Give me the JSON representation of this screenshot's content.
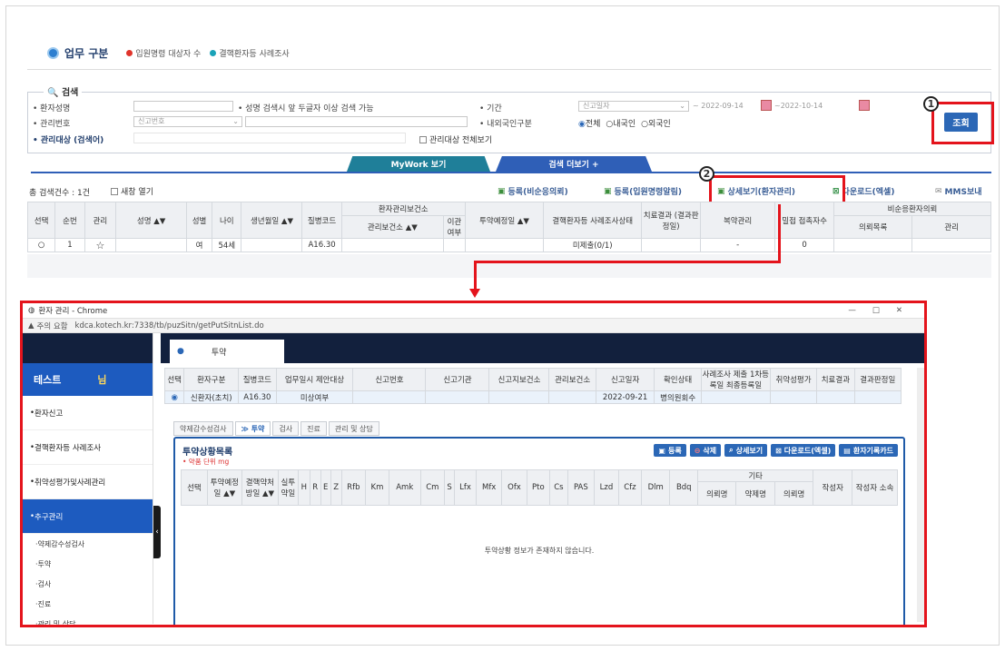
{
  "header": {
    "title": "업무 구분",
    "legend_items": [
      "입원명령 대상자 수",
      "결핵환자등 사례조사"
    ]
  },
  "search": {
    "legend": "검색",
    "patient_name_label": "환자성명",
    "patient_name_hint": "성명 검색시 앞 두글자 이상 검색 가능",
    "mgmt_no_label": "관리번호",
    "mgmt_no_value": "신고번호",
    "target_label": "관리대상 (검색어)",
    "show_all_label": "관리대상 전체보기",
    "period_label": "기간",
    "period_type": "신고일자",
    "date_from": "2022-09-14",
    "date_sep": "~",
    "date_to": "2022-10-14",
    "nationality_label": "내외국인구분",
    "nat_opts": [
      "전체",
      "내국인",
      "외국인"
    ],
    "query_button": "조회"
  },
  "tabs": {
    "mywork": "MyWork 보기",
    "more": "검색 더보기 +"
  },
  "results": {
    "count_label": "총 검색건수 : 1건",
    "new_window": "새창 열기",
    "actions": [
      "등록(비순응의뢰)",
      "등록(입원명령알림)",
      "상세보기(환자관리)",
      "다운로드(엑셀)",
      "MMS보내"
    ]
  },
  "grid": {
    "headers": [
      "선택",
      "순번",
      "관리",
      "성명 ▲▼",
      "성별",
      "나이",
      "생년월일 ▲▼",
      "질병코드",
      "관리보건소 ▲▼",
      "이관 여부",
      "투약예정일 ▲▼",
      "결핵환자등 사례조사상태",
      "치료결과 (결과판정일)",
      "복약관리",
      "밀접 접촉자수",
      "의뢰목록",
      "관리"
    ],
    "group_headers": [
      "환자관리보건소",
      "비순응환자의뢰"
    ],
    "row": {
      "seq": "1",
      "sex": "여",
      "age": "54세",
      "code": "A16.30",
      "status": "미제출(0/1)",
      "med": "-",
      "contacts": "0"
    }
  },
  "markers": {
    "one": "1",
    "two": "2"
  },
  "popup": {
    "window_title": "환자 관리 - Chrome",
    "url_warning": "주의 요함",
    "url": "kdca.kotech.kr:7338/tb/puzSitn/getPutSitnList.do",
    "tab_label": "투약",
    "side_title": "테스트",
    "side_suffix": "님",
    "side_items": [
      "환자신고",
      "결핵환자등 사례조사",
      "취약성평가및사례관리",
      "추구관리"
    ],
    "side_sub": [
      "약제감수성검사",
      "투약",
      "검사",
      "진료",
      "관리 및 상담"
    ],
    "ptable_headers": [
      "선택",
      "환자구분",
      "질병코드",
      "업무일시 제안대상",
      "신고번호",
      "신고기관",
      "신고지보건소",
      "관리보건소",
      "신고일자",
      "확인상태",
      "사례조사 제출 1차등록일 최종등록일",
      "취약성평가",
      "치료결과",
      "결과판정일"
    ],
    "prow": {
      "type": "신환자(초치)",
      "code": "A16.30",
      "target": "미상여부",
      "date": "2022-09-21",
      "state": "병의원회수"
    },
    "subtabs": [
      "약제감수성검사",
      "≫ 투약",
      "검사",
      "진료",
      "관리 및 상담"
    ],
    "section_title": "투약상황목록",
    "section_note": "• 약품 단위 mg",
    "buttons": [
      "등록",
      "삭제",
      "상세보기",
      "다운로드(엑셀)",
      "환자기록카드"
    ],
    "drug_headers": [
      "선택",
      "투약예정일 ▲▼",
      "결핵약처방일 ▲▼",
      "실투약일",
      "H",
      "R",
      "E",
      "Z",
      "Rfb",
      "Km",
      "Amk",
      "Cm",
      "S",
      "Lfx",
      "Mfx",
      "Ofx",
      "Pto",
      "Cs",
      "PAS",
      "Lzd",
      "Cfz",
      "Dlm",
      "Bdq",
      "의뢰명",
      "약제명",
      "의뢰명",
      "작성자",
      "작성자 소속"
    ],
    "etc_label": "기타",
    "empty_msg": "투약상황 정보가 존재하지 않습니다."
  }
}
